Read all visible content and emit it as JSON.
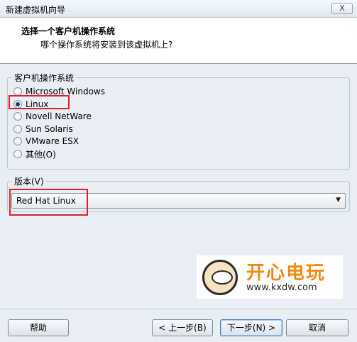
{
  "window": {
    "title": "新建虚拟机向导",
    "close_label": "X"
  },
  "header": {
    "title": "选择一个客户机操作系统",
    "subtitle": "哪个操作系统将安装到该虚拟机上?"
  },
  "os_group": {
    "legend": "客户机操作系统",
    "options": [
      {
        "label": "Microsoft Windows",
        "checked": false
      },
      {
        "label": "Linux",
        "checked": true
      },
      {
        "label": "Novell NetWare",
        "checked": false
      },
      {
        "label": "Sun Solaris",
        "checked": false
      },
      {
        "label": "VMware ESX",
        "checked": false
      },
      {
        "label": "其他(O)",
        "checked": false
      }
    ]
  },
  "version_group": {
    "legend": "版本(V)",
    "selected": "Red Hat Linux",
    "arrow_icon": "chevron-down-icon"
  },
  "watermark": {
    "brand": "开心电玩",
    "url": "www.kxdw.com"
  },
  "footer": {
    "help_label": "帮助",
    "back_label": "< 上一步(B)",
    "next_label": "下一步(N) >",
    "cancel_label": "取消"
  },
  "colors": {
    "highlight": "#e0202a",
    "selected_radio": "#1d3d67",
    "logo_orange": "#f08a12"
  }
}
